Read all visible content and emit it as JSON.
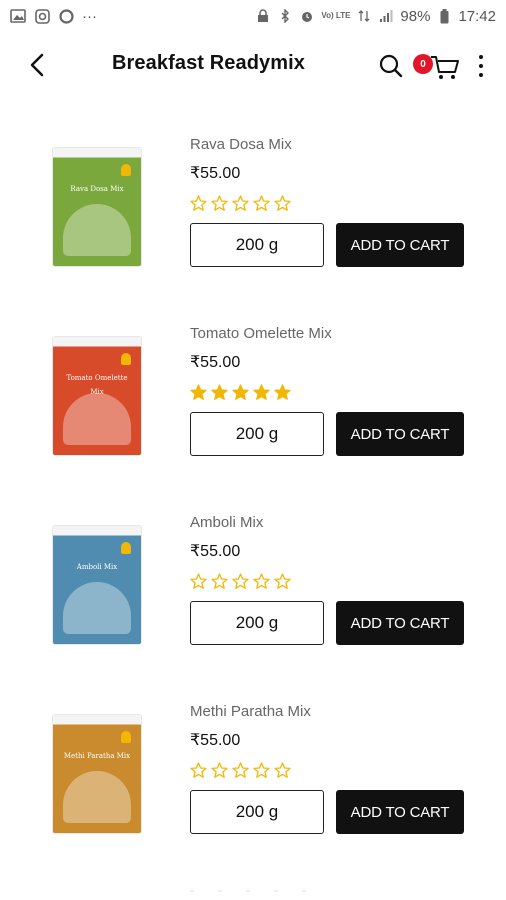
{
  "status_bar": {
    "left_icons": [
      "image-icon",
      "instagram-icon",
      "circle-icon",
      "more-notifications-icon"
    ],
    "dots_text": "···",
    "network_text": "Vo) LTE",
    "battery_text": "98%",
    "time": "17:42"
  },
  "header": {
    "title": "Breakfast Readymix",
    "cart_count": "0"
  },
  "products": [
    {
      "name": "Rava Dosa Mix",
      "price": "₹55.00",
      "rating": 0,
      "weight": "200 g",
      "add_label": "ADD TO CART",
      "package_color": "#7aa83c",
      "package_label": "Rava Dosa Mix"
    },
    {
      "name": "Tomato Omelette Mix",
      "price": "₹55.00",
      "rating": 5,
      "weight": "200 g",
      "add_label": "ADD TO CART",
      "package_color": "#d84b2a",
      "package_label": "Tomato Omelette Mix"
    },
    {
      "name": "Amboli Mix",
      "price": "₹55.00",
      "rating": 0,
      "weight": "200 g",
      "add_label": "ADD TO CART",
      "package_color": "#4f8cb0",
      "package_label": "Amboli Mix"
    },
    {
      "name": "Methi Paratha Mix",
      "price": "₹55.00",
      "rating": 0,
      "weight": "200 g",
      "add_label": "ADD TO CART",
      "package_color": "#c98b2e",
      "package_label": "Methi Paratha Mix"
    }
  ],
  "colors": {
    "star": "#f2b705",
    "badge": "#e3152b",
    "button": "#111111"
  }
}
